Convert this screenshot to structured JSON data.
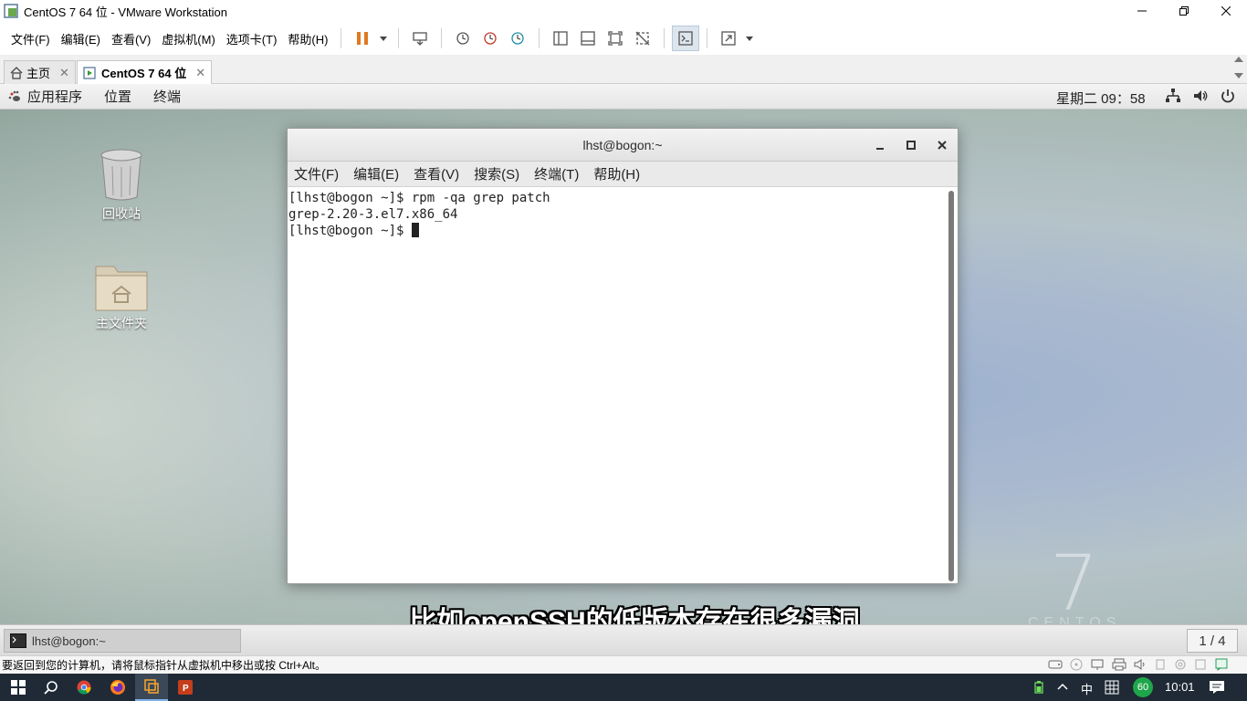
{
  "window": {
    "title": "CentOS 7 64 位 - VMware Workstation"
  },
  "vmware_menu": [
    "文件(F)",
    "编辑(E)",
    "查看(V)",
    "虚拟机(M)",
    "选项卡(T)",
    "帮助(H)"
  ],
  "tabs": [
    {
      "label": "主页"
    },
    {
      "label": "CentOS 7 64 位"
    }
  ],
  "gnome_bar": {
    "apps": "应用程序",
    "places": "位置",
    "terminal": "终端",
    "clock": "星期二 09：58"
  },
  "desktop_icons": [
    {
      "label": "回收站"
    },
    {
      "label": "主文件夹"
    }
  ],
  "centos_brand": {
    "numeral": "7",
    "word": "CENTOS"
  },
  "terminal": {
    "title": "lhst@bogon:~",
    "menu": [
      "文件(F)",
      "编辑(E)",
      "查看(V)",
      "搜索(S)",
      "终端(T)",
      "帮助(H)"
    ],
    "lines": [
      "[lhst@bogon ~]$ rpm -qa grep patch",
      "grep-2.20-3.el7.x86_64",
      "[lhst@bogon ~]$ "
    ]
  },
  "subtitle": "比如openSSH的低版本存在很多漏洞",
  "gnome_taskbar": {
    "window_label": "lhst@bogon:~",
    "pager": "1 / 4"
  },
  "vm_status": {
    "hint": "要返回到您的计算机，请将鼠标指针从虚拟机中移出或按 Ctrl+Alt。"
  },
  "win_taskbar": {
    "ime": "中",
    "badge": "60",
    "time": "10:01"
  },
  "colors": {
    "vmware_pause": "#e07a1f",
    "taskbar": "#1f2a36",
    "badge": "#1fa64a"
  }
}
